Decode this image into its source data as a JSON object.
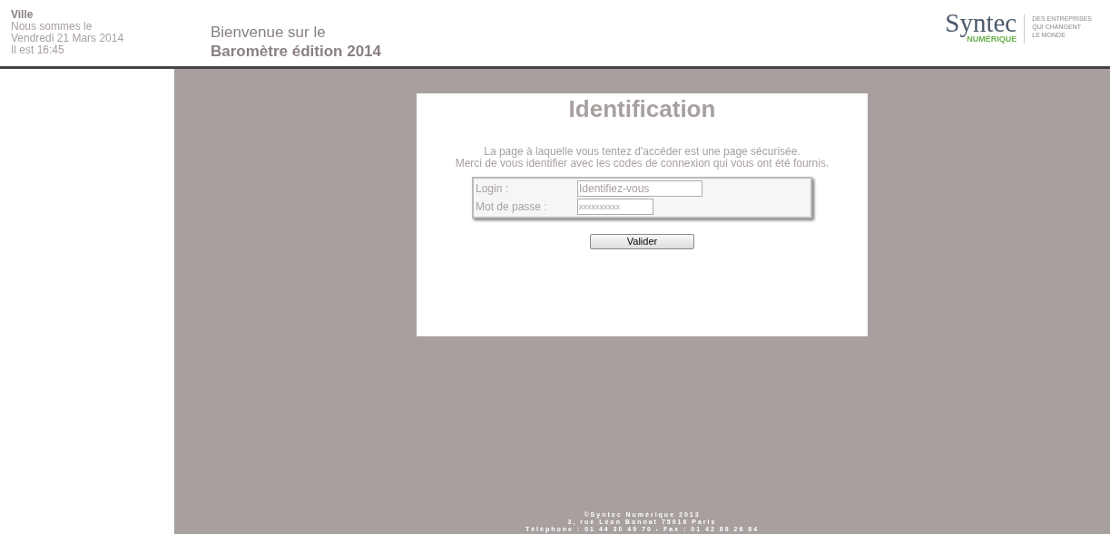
{
  "header": {
    "city": "Ville",
    "date_intro": "Nous sommes le",
    "date": "Vendredi 21 Mars 2014",
    "time": "Il est 16:45",
    "welcome": "Bienvenue sur le",
    "title": "Baromètre édition 2014"
  },
  "logo": {
    "name": "Syntec",
    "sub": "NUMÉRIQUE",
    "tagline": [
      "DES ENTREPRISES",
      "QUI CHANGENT",
      "LE MONDE"
    ]
  },
  "login": {
    "title": "Identification",
    "message": [
      "La page à laquelle vous tentez d'accéder est une page sécurisée.",
      "Merci de vous identifier avec les codes de connexion qui vous ont été fournis."
    ],
    "fields": [
      {
        "label": "Login :",
        "value": "Identifiez-vous"
      },
      {
        "label": "Mot de passe :",
        "value": "xxxxxxxxxx"
      }
    ],
    "button": "Valider"
  },
  "footer": [
    "©Syntec Numérique 2013",
    "3, rue Léon Bonnat 75016 Paris",
    "Téléphone : 01 44 30 49 70 - Fax : 01 42 88 26 84"
  ]
}
